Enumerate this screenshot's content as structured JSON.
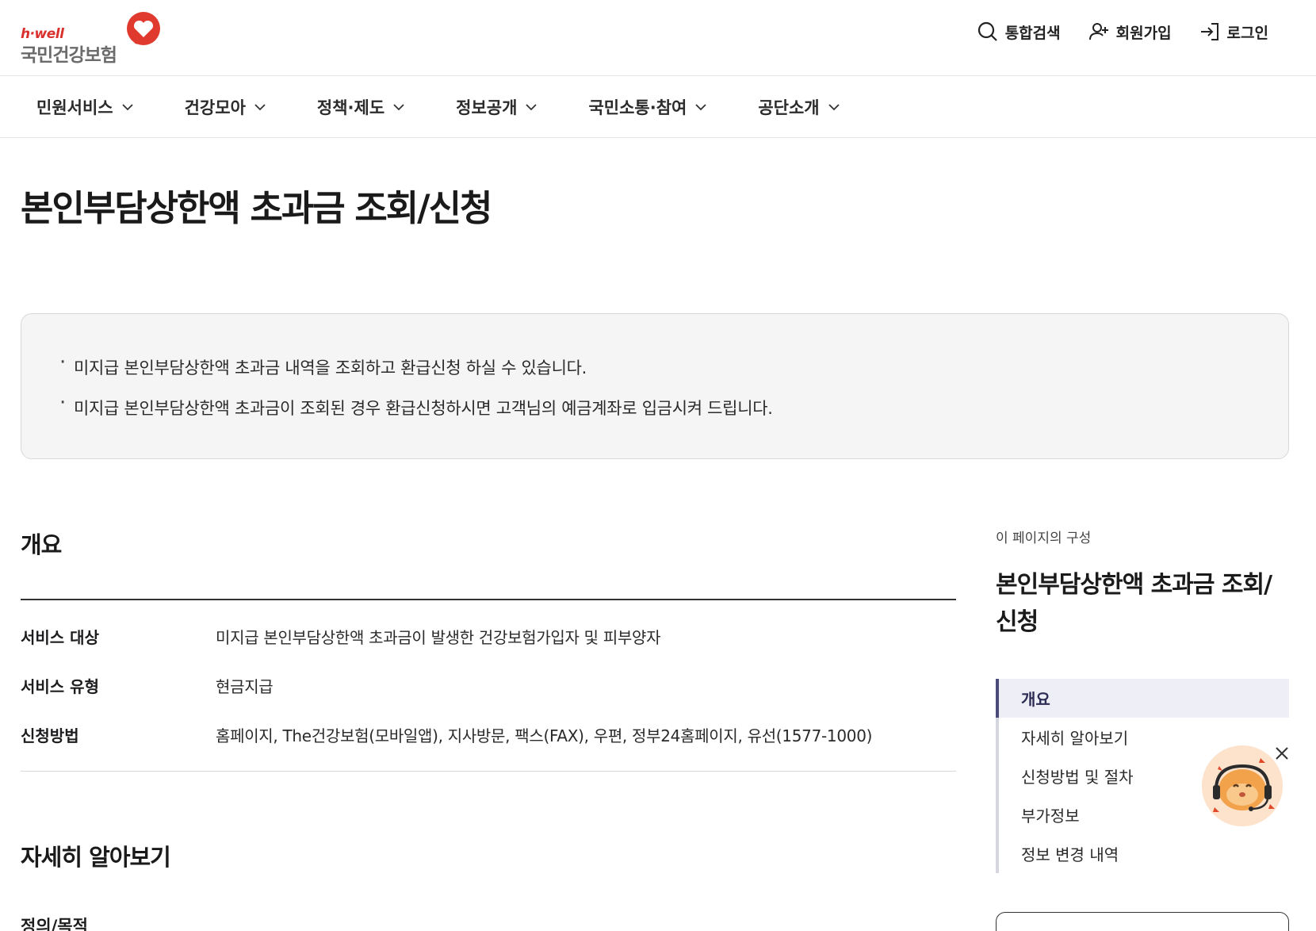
{
  "header": {
    "logo_small": "h·well",
    "logo_brand": "국민건강보험",
    "util": [
      {
        "label": "통합검색",
        "icon": "search-icon"
      },
      {
        "label": "회원가입",
        "icon": "user-plus-icon"
      },
      {
        "label": "로그인",
        "icon": "login-icon"
      }
    ]
  },
  "nav": {
    "items": [
      "민원서비스",
      "건강모아",
      "정책·제도",
      "정보공개",
      "국민소통·참여",
      "공단소개"
    ]
  },
  "page": {
    "title": "본인부담상한액 초과금 조회/신청"
  },
  "info": {
    "lines": [
      "미지급 본인부담상한액 초과금 내역을 조회하고 환급신청 하실 수 있습니다.",
      "미지급 본인부담상한액 초과금이 조회된 경우 환급신청하시면 고객님의 예금계좌로 입금시켜 드립니다."
    ]
  },
  "overview": {
    "title": "개요",
    "rows": [
      {
        "key": "서비스 대상",
        "value": "미지급 본인부담상한액 초과금이 발생한 건강보험가입자 및 피부양자"
      },
      {
        "key": "서비스 유형",
        "value": "현금지급"
      },
      {
        "key": "신청방법",
        "value": "홈페이지, The건강보험(모바일앱), 지사방문, 팩스(FAX), 우편, 정부24홈페이지, 유선(1577-1000)"
      }
    ]
  },
  "detail": {
    "title": "자세히 알아보기",
    "subhead": "정의/목적"
  },
  "toc": {
    "caption": "이 페이지의 구성",
    "title": "본인부담상한액 초과금 조회/신청",
    "items": [
      "개요",
      "자세히 알아보기",
      "신청방법 및 절차",
      "부가정보",
      "정보 변경 내역"
    ],
    "active_index": 0
  },
  "colors": {
    "brand_red": "#d9322e",
    "toc_active_bg": "#eeeef6",
    "toc_active_bar": "#4b4b7a",
    "info_bg": "#f5f5f5"
  }
}
